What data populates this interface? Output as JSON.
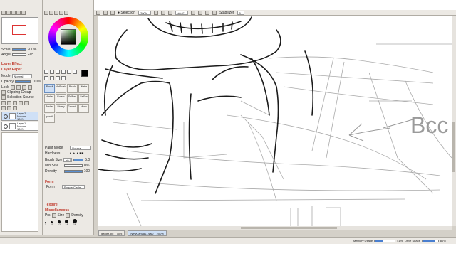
{
  "toolbar": {
    "selection_label": "Selection",
    "zoom": "200%",
    "rotation": "+0.0°",
    "stabilizer_label": "Stabilizer",
    "stabilizer_value": "5"
  },
  "navigator": {
    "zoom_label": "Scale",
    "zoom_value": "200%",
    "angle_label": "Angle",
    "angle_value": "+0°"
  },
  "layer_panel": {
    "layer_effect": "Layer Effect",
    "layer_paper": "Layer Paper",
    "mode_label": "Mode",
    "mode_value": "Normal",
    "opacity_label": "Opacity",
    "opacity_value": "100%",
    "lock_label": "Lock",
    "clipping_group": "Clipping Group",
    "selection_source": "Selection Source",
    "layers": [
      {
        "name": "Layer2",
        "mode": "Normal",
        "opacity": "100%"
      },
      {
        "name": "Layer1",
        "mode": "Normal",
        "opacity": "100%"
      }
    ]
  },
  "tools": [
    {
      "label": "Pencil",
      "selected": true
    },
    {
      "label": "AirBrush",
      "selected": false
    },
    {
      "label": "Brush",
      "selected": false
    },
    {
      "label": "Water",
      "selected": false
    },
    {
      "label": "Marker",
      "selected": false
    },
    {
      "label": "Eraser",
      "selected": false
    },
    {
      "label": "SelPen",
      "selected": false
    },
    {
      "label": "SelEra",
      "selected": false
    },
    {
      "label": "Bucket",
      "selected": false
    },
    {
      "label": "Binary",
      "selected": false
    },
    {
      "label": "Gradat...",
      "selected": false
    },
    {
      "label": "Mono",
      "selected": false
    },
    {
      "label": "pencil",
      "selected": false
    }
  ],
  "brush_settings": {
    "paint_mode_label": "Paint Mode",
    "paint_mode_value": "Normal",
    "hardness_label": "Hardness",
    "brush_size_label": "Brush Size",
    "brush_size_mult": "x0.1",
    "brush_size_value": "5.0",
    "min_size_label": "Min Size",
    "min_size_value": "0%",
    "density_label": "Density",
    "density_value": "100",
    "form_section": "Form",
    "form_label": "Form",
    "form_value": "Simple Circle",
    "texture_section": "Texture",
    "misc_section": "Miscellaneous",
    "pressure_label": "Prs",
    "size_check": "Size",
    "density_check": "Density",
    "dot_sizes": [
      "1",
      "10",
      "12",
      "14",
      "16"
    ]
  },
  "tabs": [
    {
      "label": "gaster.jpg",
      "zoom": "75%",
      "active": false
    },
    {
      "label": "NewCanvas1.sai2",
      "zoom": "200%",
      "active": true
    }
  ],
  "status": {
    "memory_label": "Memory Usage",
    "memory_value": "41%",
    "memory_fraction": 0.41,
    "drive_label": "Drive Space",
    "drive_value": "80%",
    "drive_fraction": 0.8
  },
  "canvas_text": "Bcc"
}
